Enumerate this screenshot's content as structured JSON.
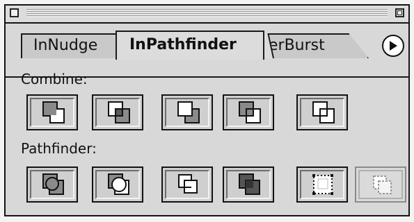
{
  "palette": {
    "title_icons": {
      "close": "close-box-icon",
      "zoom": "zoom-box-icon"
    },
    "tabs": [
      {
        "label": "InNudge",
        "state": "inactive"
      },
      {
        "label": "InPathfinder",
        "state": "active"
      },
      {
        "label": "erBurst",
        "state": "inactive"
      }
    ],
    "menu_icon": "triangle-right-icon",
    "sections": [
      {
        "label": "Combine:",
        "buttons": [
          {
            "icon": "combine-add-icon",
            "enabled": true
          },
          {
            "icon": "combine-subtract-icon",
            "enabled": true
          },
          {
            "icon": "combine-intersect-icon",
            "enabled": true
          },
          {
            "icon": "combine-exclude-overlap-icon",
            "enabled": true
          },
          {
            "icon": "combine-minus-back-icon",
            "enabled": true
          }
        ]
      },
      {
        "label": "Pathfinder:",
        "buttons": [
          {
            "icon": "pathfinder-divide-icon",
            "enabled": true
          },
          {
            "icon": "pathfinder-trim-icon",
            "enabled": true
          },
          {
            "icon": "pathfinder-crop-icon",
            "enabled": true
          },
          {
            "icon": "pathfinder-outline-icon",
            "enabled": true
          },
          {
            "icon": "pathfinder-merge-icon",
            "enabled": true
          },
          {
            "icon": "pathfinder-disabled-icon",
            "enabled": false
          }
        ]
      }
    ]
  }
}
